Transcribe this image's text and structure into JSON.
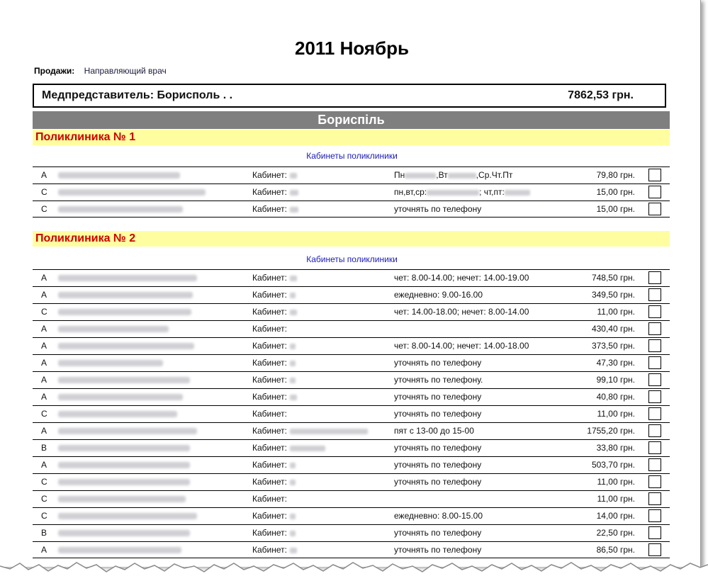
{
  "report": {
    "title": "2011 Ноябрь",
    "sales_label": "Продажи:",
    "sales_value": "Направляющий врач",
    "rep_name": "Медпредставитель: Борисполь . .",
    "rep_total": "7862,53 грн.",
    "city": "Бориспіль"
  },
  "clinics": [
    {
      "name": "Поликлиника № 1",
      "subtitle": "Кабинеты поликлиники",
      "rows": [
        {
          "cat": "A",
          "cab": "Кабинет:",
          "sched": [
            "Пн",
            ",Вт",
            ",Ср.Чт.Пт"
          ],
          "amount": "79,80 грн."
        },
        {
          "cat": "C",
          "cab": "Кабинет:",
          "sched": [
            "пн,вт,ср:",
            "; чт,пт:"
          ],
          "amount": "15,00 грн."
        },
        {
          "cat": "C",
          "cab": "Кабинет:",
          "sched": [
            "уточнять по телефону"
          ],
          "amount": "15,00 грн."
        }
      ]
    },
    {
      "name": "Поликлиника № 2",
      "subtitle": "Кабинеты поликлиники",
      "rows": [
        {
          "cat": "A",
          "cab": "Кабинет:",
          "sched": [
            "чет: 8.00-14.00; нечет: 14.00-19.00"
          ],
          "amount": "748,50 грн."
        },
        {
          "cat": "A",
          "cab": "Кабинет:",
          "sched": [
            "ежедневно: 9.00-16.00"
          ],
          "amount": "349,50 грн."
        },
        {
          "cat": "C",
          "cab": "Кабинет:",
          "sched": [
            "чет: 14.00-18.00; нечет: 8.00-14.00"
          ],
          "amount": "11,00 грн."
        },
        {
          "cat": "A",
          "cab": "Кабинет:",
          "sched": [],
          "amount": "430,40 грн."
        },
        {
          "cat": "A",
          "cab": "Кабинет:",
          "sched": [
            "чет: 8.00-14.00; нечет: 14.00-18.00"
          ],
          "amount": "373,50 грн."
        },
        {
          "cat": "A",
          "cab": "Кабинет:",
          "sched": [
            "уточнять по телефону"
          ],
          "amount": "47,30 грн."
        },
        {
          "cat": "A",
          "cab": "Кабинет:",
          "sched": [
            "уточнять по телефону."
          ],
          "amount": "99,10 грн."
        },
        {
          "cat": "A",
          "cab": "Кабинет:",
          "sched": [
            "уточнять по телефону"
          ],
          "amount": "40,80 грн."
        },
        {
          "cat": "C",
          "cab": "Кабинет:",
          "sched": [
            "уточнять по телефону"
          ],
          "amount": "11,00 грн."
        },
        {
          "cat": "A",
          "cab": "Кабинет:",
          "sched": [
            "пят с 13-00 до 15-00"
          ],
          "amount": "1755,20 грн."
        },
        {
          "cat": "B",
          "cab": "Кабинет:",
          "sched": [
            "уточнять по телефону"
          ],
          "amount": "33,80 грн."
        },
        {
          "cat": "A",
          "cab": "Кабинет:",
          "sched": [
            "уточнять по телефону"
          ],
          "amount": "503,70 грн."
        },
        {
          "cat": "C",
          "cab": "Кабинет:",
          "sched": [
            "уточнять по телефону"
          ],
          "amount": "11,00 грн."
        },
        {
          "cat": "C",
          "cab": "Кабинет:",
          "sched": [],
          "amount": "11,00 грн."
        },
        {
          "cat": "C",
          "cab": "Кабинет:",
          "sched": [
            "ежедневно: 8.00-15.00"
          ],
          "amount": "14,00 грн."
        },
        {
          "cat": "B",
          "cab": "Кабинет:",
          "sched": [
            "уточнять по телефону"
          ],
          "amount": "22,50 грн."
        },
        {
          "cat": "A",
          "cab": "Кабинет:",
          "sched": [
            "уточнять по телефону"
          ],
          "amount": "86,50 грн."
        }
      ]
    }
  ]
}
